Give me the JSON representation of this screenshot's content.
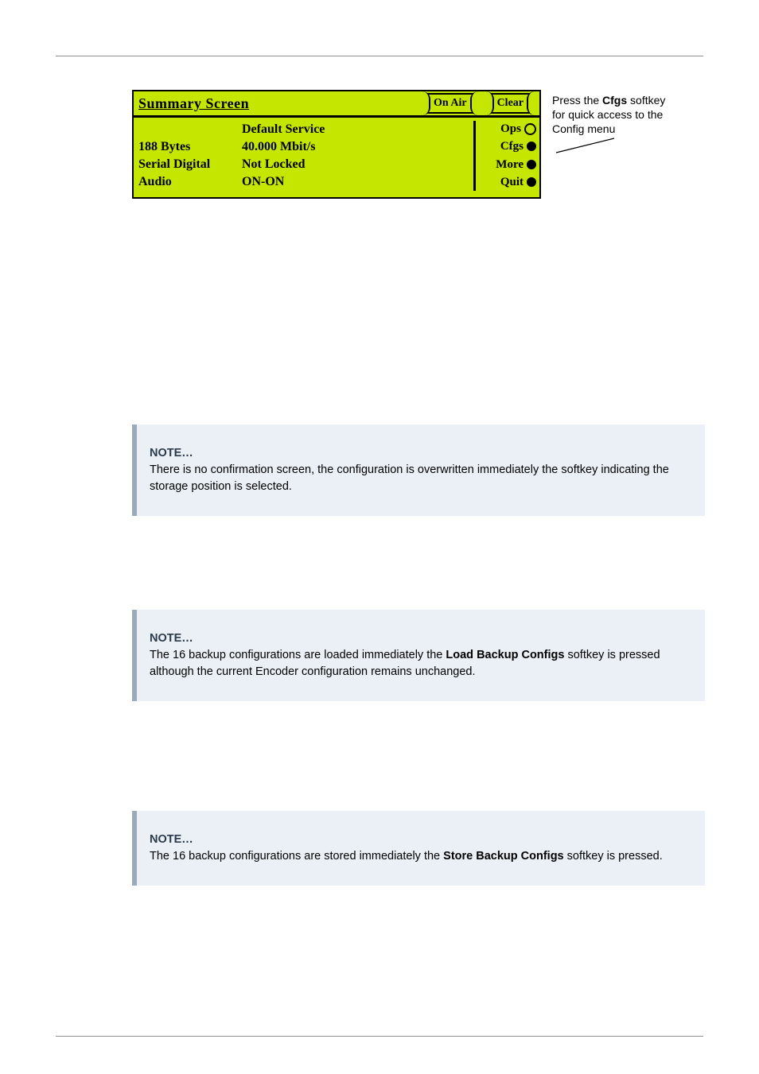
{
  "callout": {
    "line1_a": "Press the ",
    "line1_b": "Cfgs",
    "line1_c": " softkey",
    "line2": "for quick access to the",
    "line3": "Config menu"
  },
  "lcd": {
    "title": "Summary Screen",
    "chip_onair": "On Air",
    "chip_clear": "Clear",
    "service_header": "Default Service",
    "left": {
      "l1": "188 Bytes",
      "l2": "Serial Digital",
      "l3": "Audio"
    },
    "mid": {
      "m1": "40.000 Mbit/s",
      "m2": "Not Locked",
      "m3": "ON-ON"
    },
    "sk": {
      "ops": "Ops",
      "cfgs": "Cfgs",
      "more": "More",
      "quit": "Quit"
    }
  },
  "note1": {
    "label": "NOTE…",
    "text": "There is no confirmation screen, the configuration is overwritten immediately the softkey indicating the storage position is selected."
  },
  "note2": {
    "label": "NOTE…",
    "pre": "The 16 backup configurations are loaded immediately the ",
    "sk": "Load Backup Configs",
    "post": " softkey is pressed although the current Encoder configuration remains unchanged."
  },
  "note3": {
    "label": "NOTE…",
    "pre": "The 16 backup configurations are stored immediately the ",
    "sk": "Store Backup Configs",
    "post": " softkey is pressed."
  }
}
